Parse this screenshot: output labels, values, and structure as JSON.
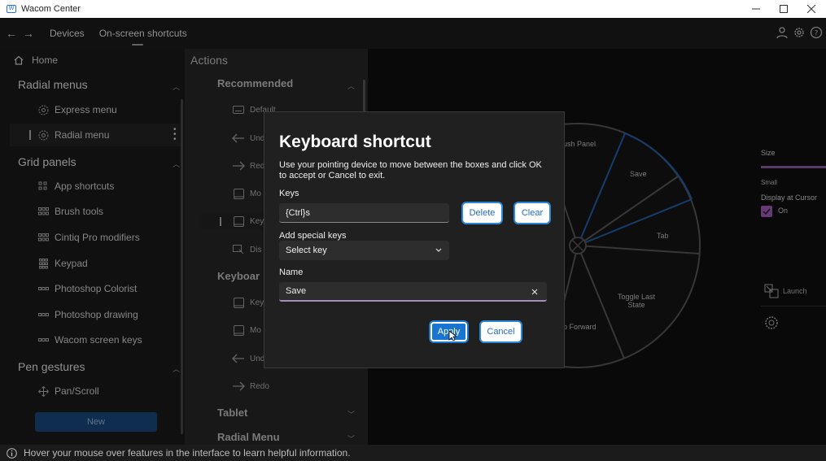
{
  "window": {
    "title": "Wacom Center"
  },
  "nav": {
    "back": "←",
    "forward": "→",
    "tabs": [
      "Devices",
      "On-screen shortcuts"
    ]
  },
  "sidebar": {
    "home": "Home",
    "sections": [
      {
        "title": "Radial menus",
        "items": [
          "Express menu",
          "Radial menu"
        ]
      },
      {
        "title": "Grid panels",
        "items": [
          "App shortcuts",
          "Brush tools",
          "Cintiq Pro modifiers",
          "Keypad",
          "Photoshop Colorist",
          "Photoshop drawing",
          "Wacom screen keys"
        ]
      },
      {
        "title": "Pen gestures",
        "items": [
          "Pan/Scroll"
        ]
      }
    ],
    "new_label": "New"
  },
  "actions": {
    "title": "Actions",
    "sections": [
      {
        "title": "Recommended",
        "items": [
          "Default",
          "Und",
          "Red",
          "Mo",
          "Key",
          "Dis"
        ]
      },
      {
        "title": "Keyboar",
        "items": [
          "Key",
          "Mo",
          "Und",
          "Redo"
        ]
      },
      {
        "title": "Tablet"
      },
      {
        "title": "Radial Menu"
      }
    ]
  },
  "radial": {
    "segments": [
      "rush Panel",
      "Save",
      "Tab",
      "Toggle Last State",
      "p Forward"
    ]
  },
  "props": {
    "size_label": "Size",
    "size_value": "Small",
    "display_label": "Display at Cursor",
    "display_value": "On",
    "launch_label": "Launch"
  },
  "dialog": {
    "title": "Keyboard shortcut",
    "description": "Use your pointing device to move between the boxes and click OK to accept or Cancel to exit.",
    "keys_label": "Keys",
    "keys_value": "{Ctrl}s",
    "delete_label": "Delete",
    "clear_label": "Clear",
    "special_label": "Add special keys",
    "special_value": "Select key",
    "name_label": "Name",
    "name_value": "Save",
    "apply_label": "Apply",
    "cancel_label": "Cancel"
  },
  "status": {
    "text": "Hover your mouse over features in the interface to learn helpful information."
  },
  "colors": {
    "accent": "#1a75d2",
    "radial_highlight": "#1f5fa8",
    "toggle": "#9b59b6"
  }
}
